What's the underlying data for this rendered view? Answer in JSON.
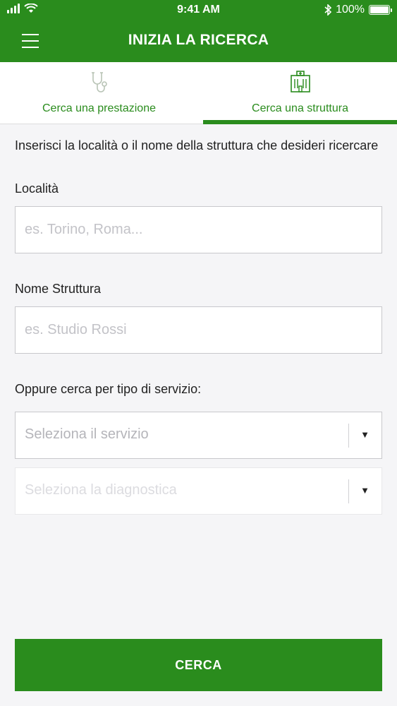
{
  "status_bar": {
    "time": "9:41 AM",
    "battery_percent": "100%"
  },
  "header": {
    "title": "INIZIA LA RICERCA"
  },
  "tabs": [
    {
      "label": "Cerca una prestazione",
      "icon": "stethoscope-icon",
      "active": false
    },
    {
      "label": "Cerca una struttura",
      "icon": "hospital-building-icon",
      "active": true
    }
  ],
  "form": {
    "intro": "Inserisci la località o il nome della struttura che desideri ricercare",
    "location": {
      "label": "Località",
      "placeholder": "es. Torino, Roma...",
      "value": ""
    },
    "facility_name": {
      "label": "Nome Struttura",
      "placeholder": "es. Studio Rossi",
      "value": ""
    },
    "service_type_label": "Oppure cerca per tipo di servizio:",
    "service_select": {
      "placeholder": "Seleziona il servizio"
    },
    "diagnostics_select": {
      "placeholder": "Seleziona la diagnostica",
      "disabled": true
    },
    "search_button": "CERCA"
  },
  "colors": {
    "brand_green": "#2a8c1d",
    "background": "#f5f5f7"
  }
}
